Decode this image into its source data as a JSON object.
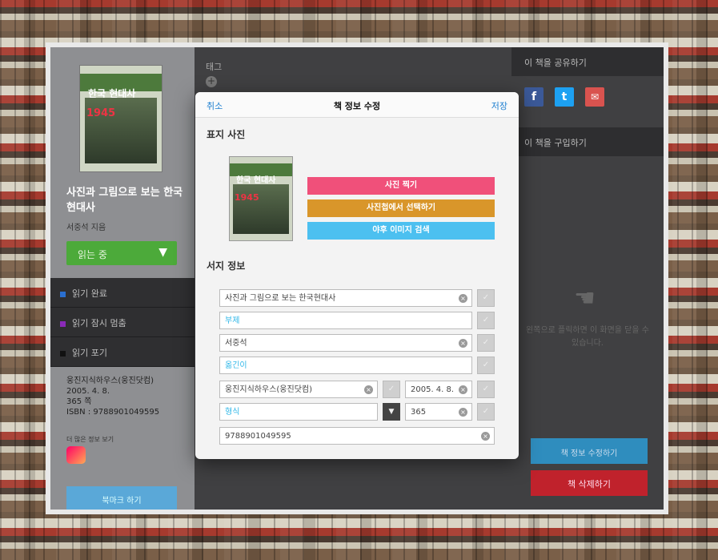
{
  "left": {
    "cover_title": "한국 현대사",
    "cover_year": "1945",
    "book_title": "사진과 그림으로 보는 한국현대사",
    "author": "서중석 지음",
    "status_label": "읽는 중",
    "menu": [
      {
        "label": "읽기 완료",
        "color": "#2a6fd0"
      },
      {
        "label": "읽기 잠시 멈춤",
        "color": "#8a2ab8"
      },
      {
        "label": "읽기 포기",
        "color": "#111111"
      }
    ],
    "publisher": "웅진지식하우스(웅진닷컴)",
    "date": "2005. 4. 8.",
    "pages": "365 쪽",
    "isbn": "ISBN : 9788901049595",
    "more_info": "더 많은 정보 보기",
    "bookmark": "북마크 하기"
  },
  "middle": {
    "tag_label": "태그",
    "tag_add": "+"
  },
  "right": {
    "share_head": "이 책을 공유하기",
    "buy_head": "이 책을 구입하기",
    "social": [
      "f",
      "t",
      "✉"
    ],
    "hint": "왼쪽으로 플릭하면 이 화면을 닫을 수 있습니다.",
    "edit_btn": "책 정보 수정하기",
    "delete_btn": "책 삭제하기"
  },
  "modal": {
    "cancel": "취소",
    "title": "책 정보 수정",
    "save": "저장",
    "cover_section": "표지 사진",
    "cover_title": "한국 현대사",
    "cover_year": "1945",
    "take_photo": "사진 찍기",
    "choose_album": "사진첩에서 선택하기",
    "yahoo_search": "야후 이미지 검색",
    "info_section": "서지 정보",
    "fields": {
      "title": "사진과 그림으로 보는 한국현대사",
      "subtitle_ph": "부제",
      "author": "서중석",
      "translator_ph": "옮긴이",
      "publisher": "웅진지식하우스(웅진닷컴)",
      "date": "2005. 4. 8.",
      "format_ph": "형식",
      "pages": "365",
      "isbn": "9788901049595"
    }
  }
}
